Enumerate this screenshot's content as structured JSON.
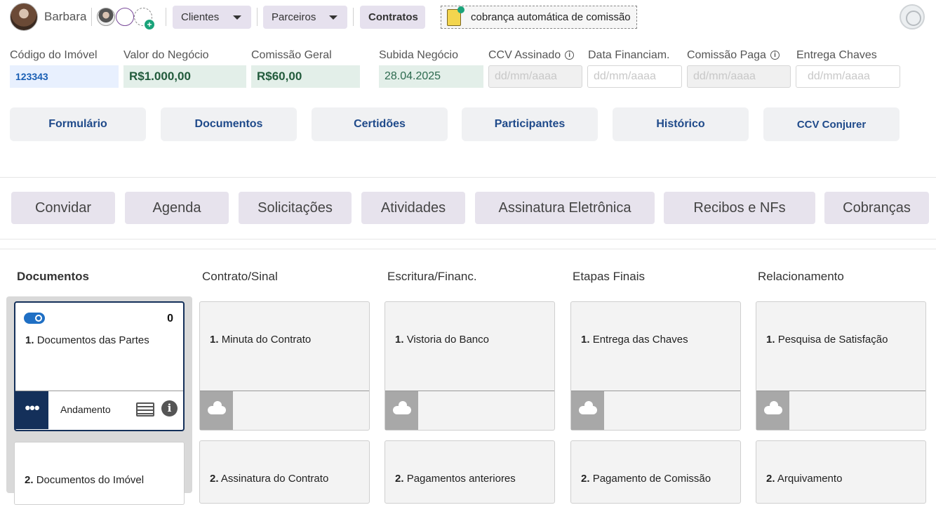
{
  "header": {
    "user_name": "Barbara",
    "menus": [
      {
        "label": "Clientes"
      },
      {
        "label": "Parceiros"
      },
      {
        "label": "Contratos"
      }
    ],
    "promo_label": "cobrança automática de comissão",
    "plus_symbol": "+"
  },
  "fields": [
    {
      "label": "Código do Imóvel",
      "value": "123343"
    },
    {
      "label": "Valor do Negócio",
      "value": "R$1.000,00"
    },
    {
      "label": "Comissão Geral",
      "value": "R$60,00"
    },
    {
      "label": "Subida Negócio",
      "value": "28.04.2025"
    },
    {
      "label": "CCV Assinado",
      "value": "dd/mm/aaaa"
    },
    {
      "label": "Data Financiam.",
      "value": "dd/mm/aaaa"
    },
    {
      "label": "Comissão Paga",
      "value": "dd/mm/aaaa"
    },
    {
      "label": "Entrega Chaves",
      "value": "dd/mm/aaaa"
    }
  ],
  "info_glyph": "i",
  "section_tabs": [
    "Formulário",
    "Documentos",
    "Certidões",
    "Participantes",
    "Histórico",
    "CCV Conjurer"
  ],
  "action_tabs": [
    "Convidar",
    "Agenda",
    "Solicitações",
    "Atividades",
    "Assinatura Eletrônica",
    "Recibos e NFs",
    "Cobranças"
  ],
  "board": {
    "columns": [
      {
        "title": "Documentos",
        "cards": [
          {
            "num": "1.",
            "title": "Documentos das Partes",
            "count": "0",
            "status": "Andamento",
            "menu_glyph": "•••"
          },
          {
            "num": "2.",
            "title": "Documentos do Imóvel"
          }
        ]
      },
      {
        "title": "Contrato/Sinal",
        "cards": [
          {
            "num": "1.",
            "title": "Minuta do Contrato"
          },
          {
            "num": "2.",
            "title": "Assinatura do Contrato"
          }
        ]
      },
      {
        "title": "Escritura/Financ.",
        "cards": [
          {
            "num": "1.",
            "title": "Vistoria do Banco"
          },
          {
            "num": "2.",
            "title": "Pagamentos anteriores"
          }
        ]
      },
      {
        "title": "Etapas Finais",
        "cards": [
          {
            "num": "1.",
            "title": "Entrega das Chaves"
          },
          {
            "num": "2.",
            "title": "Pagamento de Comissão"
          }
        ]
      },
      {
        "title": "Relacionamento",
        "cards": [
          {
            "num": "1.",
            "title": "Pesquisa de Satisfação"
          },
          {
            "num": "2.",
            "title": "Arquivamento"
          }
        ]
      }
    ]
  }
}
